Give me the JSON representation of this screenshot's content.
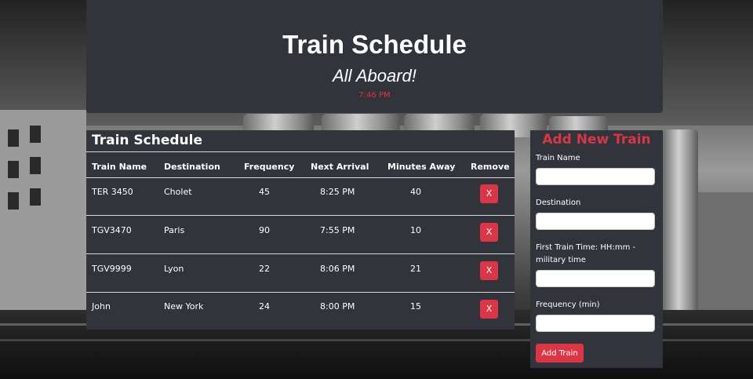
{
  "header": {
    "title": "Train Schedule",
    "subtitle": "All Aboard!",
    "current_time": "7:46 PM"
  },
  "schedule": {
    "title": "Train Schedule",
    "columns": [
      "Train Name",
      "Destination",
      "Frequency",
      "Next Arrival",
      "Minutes Away",
      "Remove"
    ],
    "rows": [
      {
        "name": "TER 3450",
        "destination": "Cholet",
        "frequency": "45",
        "next_arrival": "8:25 PM",
        "minutes_away": "40",
        "remove_label": "X"
      },
      {
        "name": "TGV3470",
        "destination": "Paris",
        "frequency": "90",
        "next_arrival": "7:55 PM",
        "minutes_away": "10",
        "remove_label": "X"
      },
      {
        "name": "TGV9999",
        "destination": "Lyon",
        "frequency": "22",
        "next_arrival": "8:06 PM",
        "minutes_away": "21",
        "remove_label": "X"
      },
      {
        "name": "John",
        "destination": "New York",
        "frequency": "24",
        "next_arrival": "8:00 PM",
        "minutes_away": "15",
        "remove_label": "X"
      }
    ]
  },
  "form": {
    "title": "Add New Train",
    "train_name_label": "Train Name",
    "train_name_value": "",
    "destination_label": "Destination",
    "destination_value": "",
    "first_time_label": "First Train Time: HH:mm - military time",
    "first_time_value": "",
    "frequency_label": "Frequency (min)",
    "frequency_value": "",
    "submit_label": "Add Train"
  },
  "colors": {
    "accent": "#dc3545",
    "panel": "#31343a"
  }
}
